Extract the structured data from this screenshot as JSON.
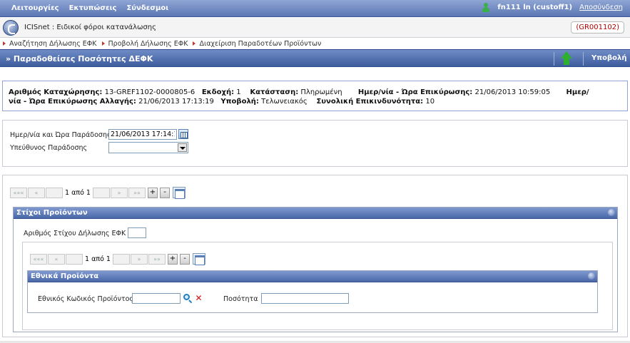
{
  "topbar": {
    "menu": [
      "Λειτουργίες",
      "Εκτυπώσεις",
      "Σύνδεσμοι"
    ],
    "user": "fn111 ln (custoff1)",
    "logout": "Αποσύνδεση"
  },
  "app": {
    "title": "ICISnet : Ειδικοί φόροι κατανάλωσης",
    "code": "(GR001102)"
  },
  "breadcrumb": [
    "Αναζήτηση Δήλωσης ΕΦΚ",
    "Προβολή Δήλωσης ΕΦΚ",
    "Διαχείριση Παραδοτέων Προϊόντων"
  ],
  "section": {
    "title": "» Παραδοθείσες Ποσότητες ΔΕΦΚ",
    "submit": "Υποβολή"
  },
  "info": {
    "reg_label": "Αριθμός Καταχώρησης:",
    "reg_value": "13-GREF1102-0000805-6",
    "version_label": "Εκδοχή:",
    "version_value": "1",
    "status_label": "Κατάσταση:",
    "status_value": "Πληρωμένη",
    "confirm_label": "Ημερ/νία - Ώρα Επικύρωσης:",
    "confirm_value": "21/06/2013 10:59:05",
    "change_label_a": "Ημερ/",
    "change_label_b": "νία - Ώρα Επικύρωσης Αλλαγής:",
    "change_value": "21/06/2013 17:13:19",
    "submission_label": "Υποβολή:",
    "submission_value": "Τελωνειακός",
    "risk_label": "Συνολική Επικινδυνότητα:",
    "risk_value": "10"
  },
  "form": {
    "delivery_date_label": "Ημερ/νία και Ώρα Παράδοσης",
    "delivery_date_value": "21/06/2013 17:14:1",
    "responsible_label": "Υπεύθυνος Παράδοσης",
    "responsible_value": ""
  },
  "pager": {
    "first": "«««",
    "prev": "«",
    "next": "»",
    "last": "»»",
    "pages": "1 από 1",
    "plus": "+",
    "minus": "-"
  },
  "lines_panel": {
    "title": "Στίχοι Προϊόντων",
    "line_no_label": "Αριθμός Στίχου Δήλωσης ΕΦΚ",
    "line_no_value": ""
  },
  "national_panel": {
    "title": "Εθνικά Προϊόντα",
    "code_label": "Εθνικός Κωδικός Προϊόντος",
    "code_value": "",
    "quantity_label": "Ποσότητα",
    "quantity_value": "",
    "clear_icon": "✕"
  }
}
